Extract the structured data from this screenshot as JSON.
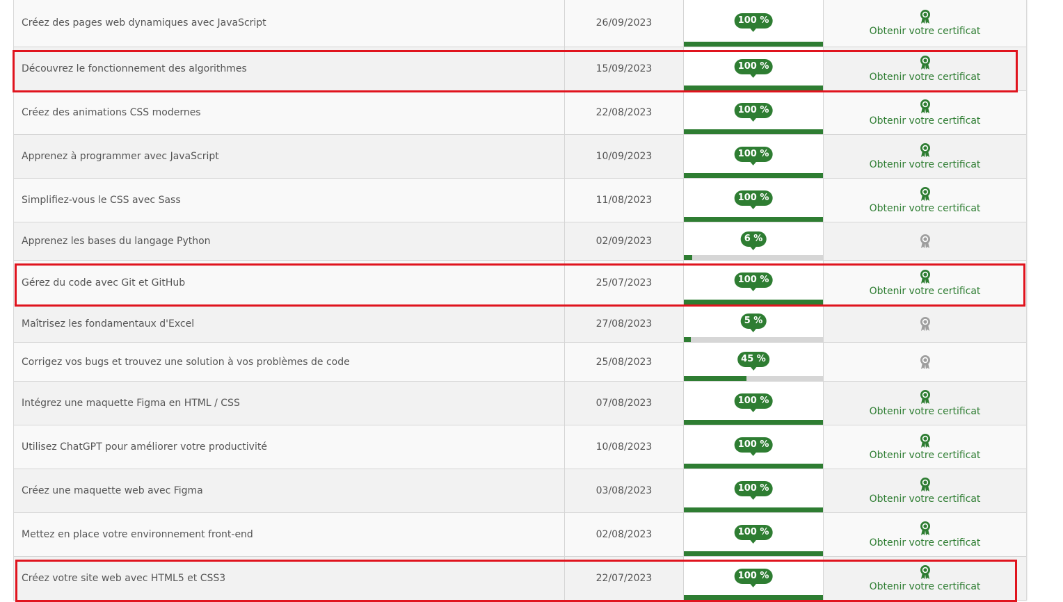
{
  "colors": {
    "accent": "#2e7d32",
    "track": "#d6d6d6",
    "highlight": "#e0141e",
    "award_gray": "#9e9e9e"
  },
  "courses": [
    {
      "title": "Créez des pages web dynamiques avec JavaScript",
      "date": "26/09/2023",
      "progress_label": "100 %",
      "progress": 100,
      "certificate": "Obtenir votre certificat",
      "icon": "award-icon",
      "highlighted": false
    },
    {
      "title": "Découvrez le fonctionnement des algorithmes",
      "date": "15/09/2023",
      "progress_label": "100 %",
      "progress": 100,
      "certificate": "Obtenir votre certificat",
      "icon": "award-icon",
      "highlighted": true
    },
    {
      "title": "Créez des animations CSS modernes",
      "date": "22/08/2023",
      "progress_label": "100 %",
      "progress": 100,
      "certificate": "Obtenir votre certificat",
      "icon": "award-icon",
      "highlighted": false
    },
    {
      "title": "Apprenez à programmer avec JavaScript",
      "date": "10/09/2023",
      "progress_label": "100 %",
      "progress": 100,
      "certificate": "Obtenir votre certificat",
      "icon": "award-icon",
      "highlighted": false
    },
    {
      "title": "Simplifiez-vous le CSS avec Sass",
      "date": "11/08/2023",
      "progress_label": "100 %",
      "progress": 100,
      "certificate": "Obtenir votre certificat",
      "icon": "award-icon",
      "highlighted": false
    },
    {
      "title": "Apprenez les bases du langage Python",
      "date": "02/09/2023",
      "progress_label": "6 %",
      "progress": 6,
      "certificate": "",
      "icon": "award-icon-gray",
      "highlighted": false
    },
    {
      "title": "Gérez du code avec Git et GitHub",
      "date": "25/07/2023",
      "progress_label": "100 %",
      "progress": 100,
      "certificate": "Obtenir votre certificat",
      "icon": "award-icon",
      "highlighted": true
    },
    {
      "title": "Maîtrisez les fondamentaux d'Excel",
      "date": "27/08/2023",
      "progress_label": "5 %",
      "progress": 5,
      "certificate": "",
      "icon": "award-icon-gray",
      "highlighted": false
    },
    {
      "title": "Corrigez vos bugs et trouvez une solution à vos problèmes de code",
      "date": "25/08/2023",
      "progress_label": "45 %",
      "progress": 45,
      "certificate": "",
      "icon": "award-icon-gray",
      "highlighted": false
    },
    {
      "title": "Intégrez une maquette Figma en HTML / CSS",
      "date": "07/08/2023",
      "progress_label": "100 %",
      "progress": 100,
      "certificate": "Obtenir votre certificat",
      "icon": "award-icon",
      "highlighted": false
    },
    {
      "title": "Utilisez ChatGPT pour améliorer votre productivité",
      "date": "10/08/2023",
      "progress_label": "100 %",
      "progress": 100,
      "certificate": "Obtenir votre certificat",
      "icon": "award-icon",
      "highlighted": false
    },
    {
      "title": "Créez une maquette web avec Figma",
      "date": "03/08/2023",
      "progress_label": "100 %",
      "progress": 100,
      "certificate": "Obtenir votre certificat",
      "icon": "award-icon",
      "highlighted": false
    },
    {
      "title": "Mettez en place votre environnement front-end",
      "date": "02/08/2023",
      "progress_label": "100 %",
      "progress": 100,
      "certificate": "Obtenir votre certificat",
      "icon": "award-icon",
      "highlighted": false
    },
    {
      "title": "Créez votre site web avec HTML5 et CSS3",
      "date": "22/07/2023",
      "progress_label": "100 %",
      "progress": 100,
      "certificate": "Obtenir votre certificat",
      "icon": "award-icon",
      "highlighted": true
    }
  ]
}
